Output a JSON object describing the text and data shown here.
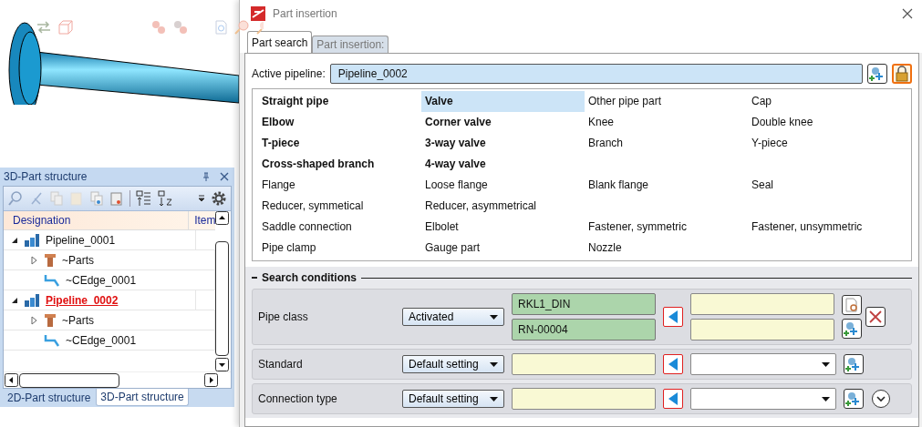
{
  "structure_panel": {
    "title": "3D-Part structure",
    "columns": [
      "Designation",
      "Item"
    ],
    "tree": [
      {
        "label": "Pipeline_0001",
        "kind": "pipeline",
        "expanded": true,
        "active": false,
        "children": [
          {
            "label": "~Parts",
            "kind": "parts",
            "expanded": false
          },
          {
            "label": "~CEdge_0001",
            "kind": "edge"
          }
        ]
      },
      {
        "label": "Pipeline_0002",
        "kind": "pipeline",
        "expanded": true,
        "active": true,
        "children": [
          {
            "label": "~Parts",
            "kind": "parts",
            "expanded": false
          },
          {
            "label": "~CEdge_0001",
            "kind": "edge"
          }
        ]
      }
    ],
    "tabs": [
      {
        "label": "2D-Part structure",
        "selected": false
      },
      {
        "label": "3D-Part structure",
        "selected": true
      }
    ]
  },
  "dialog": {
    "title": "Part insertion",
    "tabs": [
      {
        "label": "Part search",
        "selected": true
      },
      {
        "label": "Part insertion:",
        "selected": false
      }
    ],
    "active_pipeline": {
      "label": "Active pipeline:",
      "value": "Pipeline_0002",
      "locked": true
    },
    "part_types": [
      [
        {
          "label": "Straight pipe",
          "bold": true,
          "selected": false
        },
        {
          "label": "Valve",
          "bold": true,
          "selected": true
        },
        {
          "label": "Other pipe part",
          "bold": false,
          "selected": false
        },
        {
          "label": "Cap",
          "bold": false,
          "selected": false
        }
      ],
      [
        {
          "label": "Elbow",
          "bold": true,
          "selected": false
        },
        {
          "label": "Corner valve",
          "bold": true,
          "selected": false
        },
        {
          "label": "Knee",
          "bold": false,
          "selected": false
        },
        {
          "label": "Double knee",
          "bold": false,
          "selected": false
        }
      ],
      [
        {
          "label": "T-piece",
          "bold": true,
          "selected": false
        },
        {
          "label": "3-way valve",
          "bold": true,
          "selected": false
        },
        {
          "label": "Branch",
          "bold": false,
          "selected": false
        },
        {
          "label": "Y-piece",
          "bold": false,
          "selected": false
        }
      ],
      [
        {
          "label": "Cross-shaped branch",
          "bold": true,
          "selected": false
        },
        {
          "label": "4-way valve",
          "bold": true,
          "selected": false
        }
      ],
      [
        {
          "label": "Flange",
          "bold": false,
          "selected": false
        },
        {
          "label": "Loose flange",
          "bold": false,
          "selected": false
        },
        {
          "label": "Blank flange",
          "bold": false,
          "selected": false
        },
        {
          "label": "Seal",
          "bold": false,
          "selected": false
        }
      ],
      [
        {
          "label": "Reducer, symmetical",
          "bold": false,
          "selected": false
        },
        {
          "label": "Reducer, asymmetrical",
          "bold": false,
          "selected": false
        }
      ],
      [
        {
          "label": "Saddle connection",
          "bold": false,
          "selected": false
        },
        {
          "label": "Elbolet",
          "bold": false,
          "selected": false
        },
        {
          "label": "Fastener, symmetric",
          "bold": false,
          "selected": false
        },
        {
          "label": "Fastener, unsymmetric",
          "bold": false,
          "selected": false
        }
      ],
      [
        {
          "label": "Pipe clamp",
          "bold": false,
          "selected": false
        },
        {
          "label": "Gauge part",
          "bold": false,
          "selected": false
        },
        {
          "label": "Nozzle",
          "bold": false,
          "selected": false
        }
      ]
    ],
    "search_conditions": {
      "title": "Search conditions",
      "rows": [
        {
          "label": "Pipe class",
          "kind": "pair",
          "mode": "Activated",
          "values": [
            "RKL1_DIN",
            "RN-00004"
          ],
          "expander": false
        },
        {
          "label": "Standard",
          "kind": "single",
          "mode": "Default setting",
          "expander": false
        },
        {
          "label": "Connection type",
          "kind": "single",
          "mode": "Default setting",
          "expander": true
        }
      ]
    }
  }
}
